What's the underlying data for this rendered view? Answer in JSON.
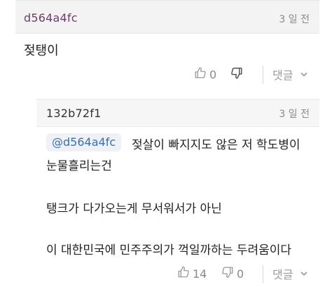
{
  "comments": [
    {
      "author": "d564a4fc",
      "time": "3 일 전",
      "text": "젖탱이",
      "likes": "0",
      "reply_label": "댓글"
    },
    {
      "author": "132b72f1",
      "time": "3 일 전",
      "mention": "@d564a4fc",
      "lines": [
        "젖살이 빠지지도 않은 저 학도병이",
        "눈물흘리는건",
        "탱크가 다가오는게 무서워서가 아닌",
        "이 대한민국에 민주주의가 꺽일까하는 두려움이다"
      ],
      "likes": "14",
      "dislikes": "0",
      "reply_label": "댓글"
    }
  ],
  "icons": {
    "thumb_up": "thumb-up-icon",
    "thumb_down": "thumb-down-icon"
  }
}
